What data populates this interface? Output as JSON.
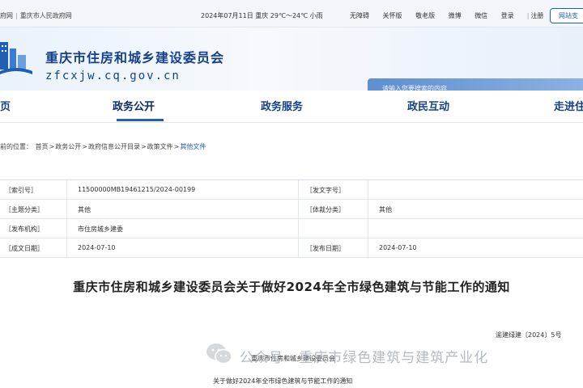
{
  "topbar": {
    "left_link_1": "府网",
    "left_link_2": "重庆市人民政府网",
    "date_weather": "2024年07月11日  重庆  29℃～24℃ 小雨",
    "links": [
      "无障碍",
      "关怀版",
      "敬老版",
      "微博",
      "微信"
    ],
    "login": "登录",
    "register": "注册",
    "pill": "网站支"
  },
  "header": {
    "title": "重庆市住房和城乡建设委员会",
    "domain": "zfcxjw.cq.gov.cn",
    "search_placeholder": "请输入您要搜索的内容"
  },
  "nav": {
    "items": [
      "页",
      "政务公开",
      "政务服务",
      "政民互动",
      "走进住"
    ],
    "active": "政务公开"
  },
  "breadcrumb": {
    "prefix": "前的位置：",
    "items": [
      "首页",
      "政务公开",
      "政府信息公开目录",
      "政策文件",
      "其他文件"
    ],
    "sep": ">"
  },
  "info": {
    "labels": {
      "index_no": "［索引号］",
      "doc_no": "［发文字号］",
      "topic": "［主题分类］",
      "genre": "［体裁分类］",
      "issuer": "［发布机构］",
      "created": "［成文日期］",
      "published": "［发布日期］"
    },
    "values": {
      "index_no": "11500000MB19461215/2024-00199",
      "doc_no": "",
      "topic": "其他",
      "genre": "其他",
      "issuer": "市住房城乡建委",
      "created": "2024-07-10",
      "published": "2024-07-10"
    }
  },
  "document": {
    "title": "重庆市住房和城乡建设委员会关于做好2024年全市绿色建筑与节能工作的通知",
    "number": "渝建绿建〔2024〕5号",
    "to_org": "重庆市住房和城乡建设委员会",
    "subject": "关于做好2024年全市绿色建筑与节能工作的通知"
  },
  "watermark": {
    "text": "公众号 · 重庆市绿色建筑与建筑产业化",
    "icon": "wechat-icon"
  },
  "colors": {
    "brand_blue": "#14418a",
    "accent_blue": "#1e5fb4",
    "search_bg": "#6f9bd8"
  }
}
